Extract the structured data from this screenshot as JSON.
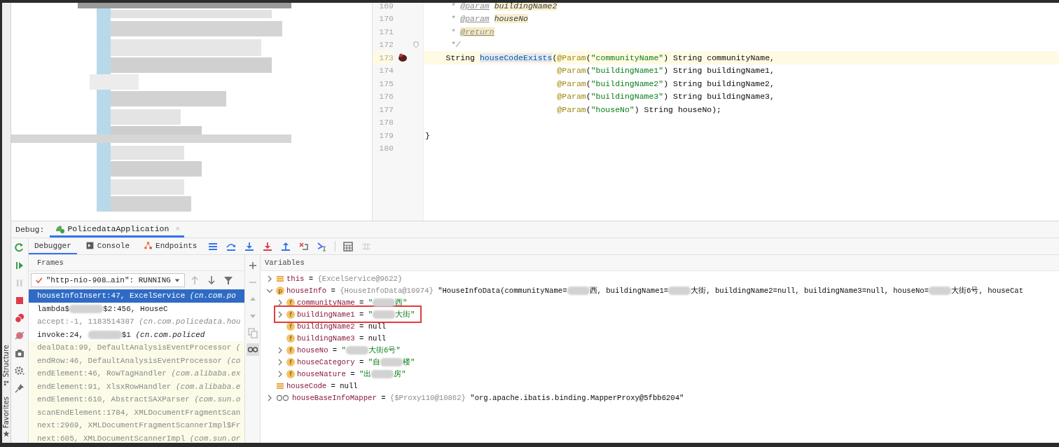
{
  "side_strip": {
    "labels": [
      {
        "kind": "structure",
        "text": "Structure"
      },
      {
        "kind": "favorites",
        "text": "Favorites"
      }
    ]
  },
  "editor": {
    "lines": [
      {
        "number": "169",
        "kind": "doc",
        "current": false,
        "breakpoint": false,
        "fold": false,
        "tokens": [
          {
            "kind": "comment",
            "text": "* "
          },
          {
            "kind": "doc-tag",
            "text": "@param"
          },
          {
            "kind": "doc-param",
            "text": "buildingName2"
          }
        ]
      },
      {
        "number": "170",
        "kind": "doc",
        "current": false,
        "breakpoint": false,
        "fold": false,
        "tokens": [
          {
            "kind": "comment",
            "text": "* "
          },
          {
            "kind": "doc-tag",
            "text": "@param"
          },
          {
            "kind": "doc-param",
            "text": "houseNo"
          }
        ]
      },
      {
        "number": "171",
        "kind": "doc",
        "current": false,
        "breakpoint": false,
        "fold": false,
        "tokens": [
          {
            "kind": "comment",
            "text": "* "
          },
          {
            "kind": "doc-return",
            "text": "@return"
          }
        ]
      },
      {
        "number": "172",
        "kind": "doc",
        "current": false,
        "breakpoint": false,
        "fold": true,
        "tokens": [
          {
            "kind": "comment",
            "text": "*/"
          }
        ]
      },
      {
        "number": "173",
        "kind": "code",
        "current": true,
        "breakpoint": true,
        "fold": false,
        "tokens": [
          {
            "kind": "plain",
            "text": "String "
          },
          {
            "kind": "method",
            "text": "houseCodeExists"
          },
          {
            "kind": "plain",
            "text": "("
          },
          {
            "kind": "annotation",
            "text": "@Param"
          },
          {
            "kind": "plain",
            "text": "("
          },
          {
            "kind": "string",
            "text": "\"communityName\""
          },
          {
            "kind": "plain",
            "text": ") String communityName,"
          }
        ]
      },
      {
        "number": "174",
        "kind": "continuation",
        "current": false,
        "breakpoint": false,
        "fold": false,
        "tokens": [
          {
            "kind": "annotation",
            "text": "@Param"
          },
          {
            "kind": "plain",
            "text": "("
          },
          {
            "kind": "string",
            "text": "\"buildingName1\""
          },
          {
            "kind": "plain",
            "text": ") String buildingName1,"
          }
        ]
      },
      {
        "number": "175",
        "kind": "continuation",
        "current": false,
        "breakpoint": false,
        "fold": false,
        "tokens": [
          {
            "kind": "annotation",
            "text": "@Param"
          },
          {
            "kind": "plain",
            "text": "("
          },
          {
            "kind": "string",
            "text": "\"buildingName2\""
          },
          {
            "kind": "plain",
            "text": ") String buildingName2,"
          }
        ]
      },
      {
        "number": "176",
        "kind": "continuation",
        "current": false,
        "breakpoint": false,
        "fold": false,
        "tokens": [
          {
            "kind": "annotation",
            "text": "@Param"
          },
          {
            "kind": "plain",
            "text": "("
          },
          {
            "kind": "string",
            "text": "\"buildingName3\""
          },
          {
            "kind": "plain",
            "text": ") String buildingName3,"
          }
        ]
      },
      {
        "number": "177",
        "kind": "continuation",
        "current": false,
        "breakpoint": false,
        "fold": false,
        "tokens": [
          {
            "kind": "annotation",
            "text": "@Param"
          },
          {
            "kind": "plain",
            "text": "("
          },
          {
            "kind": "string",
            "text": "\"houseNo\""
          },
          {
            "kind": "plain",
            "text": ") String houseNo);"
          }
        ]
      },
      {
        "number": "178",
        "kind": "blank",
        "current": false,
        "breakpoint": false,
        "fold": false
      },
      {
        "number": "179",
        "kind": "close",
        "current": false,
        "breakpoint": false,
        "fold": false,
        "tokens": [
          {
            "kind": "plain",
            "text": "}"
          }
        ]
      },
      {
        "number": "180",
        "kind": "blank",
        "current": false,
        "breakpoint": false,
        "fold": false
      }
    ]
  },
  "debug": {
    "label": "Debug:",
    "session_tab": {
      "title": "PolicedataApplication",
      "close": "×",
      "selected": true
    },
    "tabs": [
      {
        "kind": "debugger",
        "label": "Debugger",
        "selected": true
      },
      {
        "kind": "console",
        "label": "Console",
        "selected": false
      },
      {
        "kind": "endpoints",
        "label": "Endpoints",
        "selected": false
      }
    ],
    "toolbar": [
      {
        "kind": "menu",
        "disabled": false
      },
      {
        "kind": "step-over",
        "disabled": false
      },
      {
        "kind": "step-into",
        "disabled": false
      },
      {
        "kind": "force-step-into",
        "disabled": false
      },
      {
        "kind": "step-out",
        "disabled": false
      },
      {
        "kind": "drop-frame",
        "disabled": false
      },
      {
        "kind": "run-to-cursor",
        "disabled": false
      },
      {
        "kind": "separator"
      },
      {
        "kind": "evaluate",
        "disabled": false
      },
      {
        "kind": "trace",
        "disabled": true
      }
    ],
    "side_actions": [
      {
        "kind": "rerun",
        "disabled": false
      },
      {
        "kind": "resume",
        "disabled": false
      },
      {
        "kind": "pause",
        "disabled": true
      },
      {
        "kind": "stop",
        "disabled": false
      },
      {
        "kind": "breakpoints",
        "disabled": false
      },
      {
        "kind": "mute",
        "disabled": false
      },
      {
        "kind": "camera",
        "disabled": false
      },
      {
        "kind": "settings",
        "disabled": false
      },
      {
        "kind": "pin",
        "disabled": false
      }
    ],
    "frames": {
      "title": "Frames",
      "thread": {
        "value": "\"http-nio-908…ain\": RUNNING"
      },
      "nav": [
        {
          "kind": "up",
          "disabled": true
        },
        {
          "kind": "down",
          "disabled": false
        },
        {
          "kind": "filter",
          "disabled": false
        }
      ],
      "items": [
        {
          "kind": "project",
          "selected": true,
          "parts": [
            {
              "kind": "text",
              "text": "houseInfoInsert:47, ExcelService "
            },
            {
              "kind": "package",
              "text": "(cn.com.po"
            }
          ]
        },
        {
          "kind": "project",
          "selected": false,
          "parts": [
            {
              "kind": "text",
              "text": "lambda$"
            },
            {
              "kind": "redacted"
            },
            {
              "kind": "text",
              "text": "$2:456, HouseC"
            }
          ]
        },
        {
          "kind": "synthetic",
          "selected": false,
          "parts": [
            {
              "kind": "text",
              "text": "accept:-1, 1183514387 "
            },
            {
              "kind": "package",
              "text": "(cn.com.policedata.hou"
            }
          ]
        },
        {
          "kind": "project",
          "selected": false,
          "parts": [
            {
              "kind": "text",
              "text": "invoke:24, "
            },
            {
              "kind": "redacted"
            },
            {
              "kind": "text",
              "text": "$1 "
            },
            {
              "kind": "package",
              "text": "(cn.com.policed"
            }
          ]
        },
        {
          "kind": "library",
          "selected": false,
          "parts": [
            {
              "kind": "text",
              "text": "dealData:99, DefaultAnalysisEventProcessor "
            },
            {
              "kind": "package",
              "text": "("
            }
          ]
        },
        {
          "kind": "library",
          "selected": false,
          "parts": [
            {
              "kind": "text",
              "text": "endRow:46, DefaultAnalysisEventProcessor "
            },
            {
              "kind": "package",
              "text": "(co"
            }
          ]
        },
        {
          "kind": "library",
          "selected": false,
          "parts": [
            {
              "kind": "text",
              "text": "endElement:46, RowTagHandler "
            },
            {
              "kind": "package",
              "text": "(com.alibaba.ex"
            }
          ]
        },
        {
          "kind": "library",
          "selected": false,
          "parts": [
            {
              "kind": "text",
              "text": "endElement:91, XlsxRowHandler "
            },
            {
              "kind": "package",
              "text": "(com.alibaba.e"
            }
          ]
        },
        {
          "kind": "library",
          "selected": false,
          "parts": [
            {
              "kind": "text",
              "text": "endElement:610, AbstractSAXParser "
            },
            {
              "kind": "package",
              "text": "(com.sun.o"
            }
          ]
        },
        {
          "kind": "library",
          "selected": false,
          "parts": [
            {
              "kind": "text",
              "text": "scanEndElement:1784, XMLDocumentFragmentScan"
            }
          ]
        },
        {
          "kind": "library",
          "selected": false,
          "parts": [
            {
              "kind": "text",
              "text": "next:2969, XMLDocumentFragmentScannerImpl$Fr"
            }
          ]
        },
        {
          "kind": "library",
          "selected": false,
          "parts": [
            {
              "kind": "text",
              "text": "next:605, XMLDocumentScannerImpl "
            },
            {
              "kind": "package",
              "text": "(com.sun.or"
            }
          ]
        }
      ]
    },
    "watch_actions": [
      {
        "kind": "add",
        "disabled": false
      },
      {
        "kind": "remove",
        "disabled": true
      },
      {
        "kind": "move-up",
        "disabled": true
      },
      {
        "kind": "move-down",
        "disabled": true
      },
      {
        "kind": "copy",
        "disabled": true
      },
      {
        "kind": "inline",
        "disabled": false
      }
    ],
    "variables": {
      "title": "Variables",
      "items": [
        {
          "name": "this",
          "icon": {
            "kind": "stack"
          },
          "expandable": true,
          "expanded": false,
          "boxed": false,
          "value": [
            {
              "kind": "op",
              "text": "="
            },
            {
              "kind": "ref",
              "text": "{ExcelService@9622}"
            }
          ]
        },
        {
          "name": "houseInfo",
          "icon": {
            "kind": "letter",
            "letter": "p"
          },
          "expandable": true,
          "expanded": true,
          "boxed": false,
          "value": [
            {
              "kind": "op",
              "text": "="
            },
            {
              "kind": "ref",
              "text": "{HouseInfoData@10974}"
            },
            {
              "kind": "plain",
              "text": " \"HouseInfoData(communityName="
            },
            {
              "kind": "redacted"
            },
            {
              "kind": "plain",
              "text": "西, buildingName1="
            },
            {
              "kind": "redacted"
            },
            {
              "kind": "plain",
              "text": "大街, buildingName2=null, buildingName3=null, houseNo="
            },
            {
              "kind": "redacted"
            },
            {
              "kind": "plain",
              "text": "大街6号, houseCat"
            }
          ],
          "children": [
            {
              "name": "communityName",
              "icon": {
                "kind": "letter",
                "letter": "f"
              },
              "expandable": true,
              "expanded": false,
              "boxed": false,
              "value": [
                {
                  "kind": "op",
                  "text": "="
                },
                {
                  "kind": "string",
                  "text": "\""
                },
                {
                  "kind": "redacted"
                },
                {
                  "kind": "string",
                  "text": "西\""
                }
              ]
            },
            {
              "name": "buildingName1",
              "icon": {
                "kind": "letter",
                "letter": "f"
              },
              "expandable": true,
              "expanded": false,
              "boxed": true,
              "value": [
                {
                  "kind": "op",
                  "text": "="
                },
                {
                  "kind": "string",
                  "text": "\""
                },
                {
                  "kind": "redacted"
                },
                {
                  "kind": "string",
                  "text": "大街\""
                }
              ]
            },
            {
              "name": "buildingName2",
              "icon": {
                "kind": "letter",
                "letter": "f"
              },
              "expandable": false,
              "boxed": false,
              "value": [
                {
                  "kind": "op",
                  "text": "="
                },
                {
                  "kind": "plain",
                  "text": "null"
                }
              ]
            },
            {
              "name": "buildingName3",
              "icon": {
                "kind": "letter",
                "letter": "f"
              },
              "expandable": false,
              "boxed": false,
              "value": [
                {
                  "kind": "op",
                  "text": "="
                },
                {
                  "kind": "plain",
                  "text": "null"
                }
              ]
            },
            {
              "name": "houseNo",
              "icon": {
                "kind": "letter",
                "letter": "f"
              },
              "expandable": true,
              "expanded": false,
              "boxed": false,
              "value": [
                {
                  "kind": "op",
                  "text": "="
                },
                {
                  "kind": "string",
                  "text": "\""
                },
                {
                  "kind": "redacted"
                },
                {
                  "kind": "string",
                  "text": "大街6号\""
                }
              ]
            },
            {
              "name": "houseCategory",
              "icon": {
                "kind": "letter",
                "letter": "f"
              },
              "expandable": true,
              "expanded": false,
              "boxed": false,
              "value": [
                {
                  "kind": "op",
                  "text": "="
                },
                {
                  "kind": "string",
                  "text": "\"自"
                },
                {
                  "kind": "redacted"
                },
                {
                  "kind": "string",
                  "text": "楼\""
                }
              ]
            },
            {
              "name": "houseNature",
              "icon": {
                "kind": "letter",
                "letter": "f"
              },
              "expandable": true,
              "expanded": false,
              "boxed": false,
              "value": [
                {
                  "kind": "op",
                  "text": "="
                },
                {
                  "kind": "string",
                  "text": "\"出"
                },
                {
                  "kind": "redacted"
                },
                {
                  "kind": "string",
                  "text": "房\""
                }
              ]
            }
          ]
        },
        {
          "name": "houseCode",
          "icon": {
            "kind": "stack"
          },
          "expandable": false,
          "boxed": false,
          "value": [
            {
              "kind": "op",
              "text": "="
            },
            {
              "kind": "plain",
              "text": "null"
            }
          ]
        },
        {
          "name": "houseBaseInfoMapper",
          "icon": {
            "kind": "glasses"
          },
          "expandable": true,
          "expanded": false,
          "boxed": false,
          "value": [
            {
              "kind": "op",
              "text": "="
            },
            {
              "kind": "ref",
              "text": "{$Proxy110@10862}"
            },
            {
              "kind": "plain",
              "text": " \"org.apache.ibatis.binding.MapperProxy@5fbb6204\""
            }
          ]
        }
      ]
    }
  }
}
